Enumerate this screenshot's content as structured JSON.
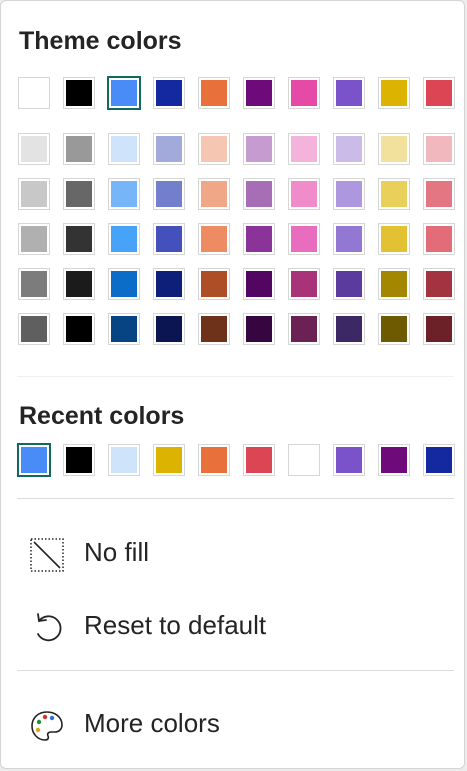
{
  "theme": {
    "title": "Theme colors",
    "base_row": [
      "#ffffff",
      "#000000",
      "#4a8cf7",
      "#1428a0",
      "#e8703a",
      "#6e0a7a",
      "#e54aa7",
      "#7a52c9",
      "#dcb400",
      "#dc4654"
    ],
    "shades": [
      [
        "#e3e3e3",
        "#999999",
        "#cfe3fb",
        "#a2aadc",
        "#f5c7b2",
        "#c69cd0",
        "#f4b3db",
        "#cbbbe9",
        "#f2e19c",
        "#f1b8be"
      ],
      [
        "#c8c8c8",
        "#676767",
        "#76b5f7",
        "#737fcd",
        "#efa788",
        "#a86eb5",
        "#ef8cc9",
        "#ad97de",
        "#e9d05b",
        "#e37682"
      ],
      [
        "#b0b0b0",
        "#333333",
        "#46a3f8",
        "#4451bd",
        "#ed8c63",
        "#8a3399",
        "#e96dbf",
        "#9277d3",
        "#e2c232",
        "#e26c78"
      ],
      [
        "#7c7c7c",
        "#1b1b1b",
        "#0c6dc9",
        "#0e1f7a",
        "#ad4e26",
        "#530562",
        "#a83378",
        "#5b3b9e",
        "#a48700",
        "#a33340"
      ],
      [
        "#5f5f5f",
        "#000000",
        "#074484",
        "#0a1552",
        "#6e3119",
        "#360640",
        "#6c2154",
        "#3d2866",
        "#6e5a00",
        "#6c2027"
      ]
    ],
    "selected_index": 2
  },
  "recent": {
    "title": "Recent colors",
    "colors": [
      "#4a8cf7",
      "#000000",
      "#cfe3fb",
      "#dcb400",
      "#e8703a",
      "#dc4654",
      "#ffffff",
      "#7a52c9",
      "#6e0a7a",
      "#1428a0"
    ],
    "selected_index": 0
  },
  "menu": {
    "no_fill": "No fill",
    "reset": "Reset to default",
    "more_colors": "More colors"
  },
  "icons": {
    "no_fill": "no-fill-icon",
    "reset": "reset-arrow-icon",
    "more_colors": "palette-icon"
  }
}
